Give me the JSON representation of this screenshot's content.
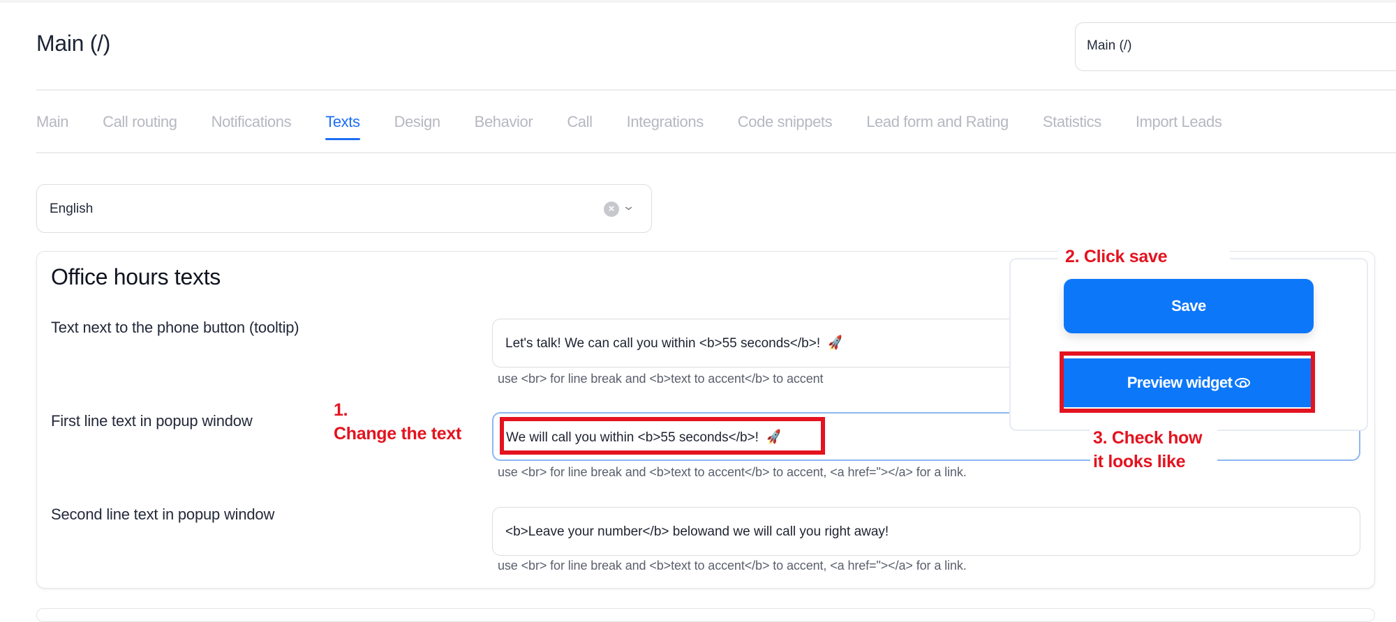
{
  "header": {
    "title": "Main (/)",
    "page_selector_value": "Main  (/)"
  },
  "tabs": [
    {
      "label": "Main",
      "active": false
    },
    {
      "label": "Call routing",
      "active": false
    },
    {
      "label": "Notifications",
      "active": false
    },
    {
      "label": "Texts",
      "active": true
    },
    {
      "label": "Design",
      "active": false
    },
    {
      "label": "Behavior",
      "active": false
    },
    {
      "label": "Call",
      "active": false
    },
    {
      "label": "Integrations",
      "active": false
    },
    {
      "label": "Code snippets",
      "active": false
    },
    {
      "label": "Lead form and Rating",
      "active": false
    },
    {
      "label": "Statistics",
      "active": false
    },
    {
      "label": "Import Leads",
      "active": false
    }
  ],
  "language_select": {
    "value": "English",
    "clear_icon": "x-circle-icon",
    "chevron_icon": "chevron-down-icon"
  },
  "section": {
    "title": "Office hours texts",
    "fields": [
      {
        "label": "Text next to the phone button (tooltip)",
        "value": "Let's talk! We can call you within <b>55 seconds</b>! ",
        "emoji": "🚀",
        "hint": "use <br> for line break and <b>text to accent</b> to accent"
      },
      {
        "label": "First line text in popup window",
        "value": "We will call you within <b>55 seconds</b>! ",
        "emoji": "🚀",
        "hint": "use <br> for line break and <b>text to accent</b> to accent, <a href=\"></a> for a link."
      },
      {
        "label": "Second line text in popup window",
        "value": "<b>Leave your number</b> belowand we will call you right away!",
        "hint": "use <br> for line break and <b>text to accent</b> to accent, <a href=\"></a> for a link."
      }
    ]
  },
  "actions": {
    "save_label": "Save",
    "preview_label": "Preview widget",
    "preview_icon": "eye-icon"
  },
  "annotations": {
    "step1_line1": "1.",
    "step1_line2": "Change the text",
    "step2": "2. Click save",
    "step3_line1": "3. Check how",
    "step3_line2": "it looks like",
    "highlight_color": "#e3131f"
  },
  "colors": {
    "accent": "#1b6ef5",
    "button": "#0d77fa",
    "tab_inactive": "#b6b8c0"
  }
}
